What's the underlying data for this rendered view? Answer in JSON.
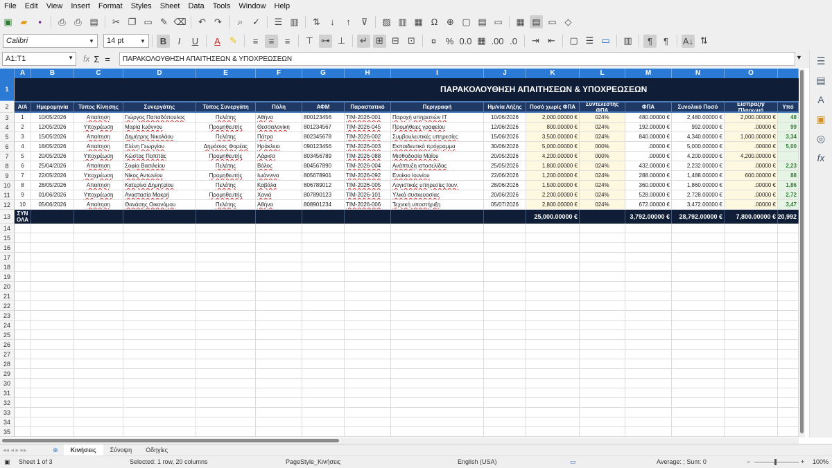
{
  "menu": [
    "File",
    "Edit",
    "View",
    "Insert",
    "Format",
    "Styles",
    "Sheet",
    "Data",
    "Tools",
    "Window",
    "Help"
  ],
  "font": {
    "name": "Calibri",
    "size": "14 pt"
  },
  "format_buttons": {
    "bold": "B",
    "italic": "I",
    "underline": "U"
  },
  "namebox": "A1:T1",
  "formula": "ΠΑΡΑΚΟΛΟΥΘΗΣΗ ΑΠΑΙΤΗΣΕΩΝ & ΥΠΟΧΡΕΩΣΕΩΝ",
  "title": "ΠΑΡΑΚΟΛΟΥΘΗΣΗ ΑΠΑΙΤΗΣΕΩΝ & ΥΠΟΧΡΕΩΣΕΩΝ",
  "column_letters": [
    "A",
    "B",
    "C",
    "D",
    "E",
    "F",
    "G",
    "H",
    "I",
    "J",
    "K",
    "L",
    "M",
    "N",
    "O",
    ""
  ],
  "headers": [
    "Α/Α",
    "Ημερομηνία",
    "Τύπος Κίνησης",
    "Συνεργάτης",
    "Τύπος Συνεργάτη",
    "Πόλη",
    "ΑΦΜ",
    "Παραστατικό",
    "Περιγραφή",
    "Ημ/νία Λήξης",
    "Ποσό χωρίς ΦΠΑ",
    "Συντελεστής ΦΠΑ",
    "ΦΠΑ",
    "Συνολικό Ποσό",
    "Είσπραξη/ Πληρωμή",
    "Υπό"
  ],
  "rows": [
    [
      "1",
      "10/05/2026",
      "Απαίτηση",
      "Γιώργος Παπαδόπουλος",
      "Πελάτης",
      "Αθήνα",
      "800123456",
      "ΤΙΜ-2026-001",
      "Παροχή υπηρεσιών IT",
      "10/06/2026",
      "2,000.00000 €",
      "024%",
      "480.00000 €",
      "2,480.00000 €",
      "2,000.00000 €",
      "48"
    ],
    [
      "2",
      "12/05/2026",
      "Υποχρέωση",
      "Μαρία Ιωάννου",
      "Προμηθευτής",
      "Θεσσαλονίκη",
      "801234567",
      "ΤΙΜ-2026-045",
      "Προμήθειες γραφείου",
      "12/06/2026",
      "800.00000 €",
      "024%",
      "192.00000 €",
      "992.00000 €",
      ".00000 €",
      "99"
    ],
    [
      "3",
      "15/05/2026",
      "Απαίτηση",
      "Δημήτρης Νικολάου",
      "Πελάτης",
      "Πάτρα",
      "802345678",
      "ΤΙΜ-2026-002",
      "Συμβουλευτικές υπηρεσίες",
      "15/06/2026",
      "3,500.00000 €",
      "024%",
      "840.00000 €",
      "4,340.00000 €",
      "1,000.00000 €",
      "3,34"
    ],
    [
      "4",
      "18/05/2026",
      "Απαίτηση",
      "Ελένη Γεωργίου",
      "Δημόσιος Φορέας",
      "Ηράκλειο",
      "090123456",
      "ΤΙΜ-2026-003",
      "Εκπαιδευτικό πρόγραμμα",
      "30/06/2026",
      "5,000.00000 €",
      "000%",
      ".00000 €",
      "5,000.00000 €",
      ".00000 €",
      "5,00"
    ],
    [
      "5",
      "20/05/2026",
      "Υποχρέωση",
      "Κώστας Παππάς",
      "Προμηθευτής",
      "Λάρισα",
      "803456789",
      "ΤΙΜ-2026-088",
      "Μισθοδοσία Μαΐου",
      "20/05/2026",
      "4,200.00000 €",
      "000%",
      ".00000 €",
      "4,200.00000 €",
      "4,200.00000 €",
      ""
    ],
    [
      "6",
      "25/04/2026",
      "Απαίτηση",
      "Σοφία Βασιλείου",
      "Πελάτης",
      "Βόλος",
      "804567890",
      "ΤΙΜ-2026-004",
      "Ανάπτυξη ιστοσελίδας",
      "25/05/2026",
      "1,800.00000 €",
      "024%",
      "432.00000 €",
      "2,232.00000 €",
      ".00000 €",
      "2,23"
    ],
    [
      "7",
      "22/05/2026",
      "Υποχρέωση",
      "Νίκος Αντωνίου",
      "Προμηθευτής",
      "Ιωάννινα",
      "805678901",
      "ΤΙΜ-2026-092",
      "Ενοίκιο Ιουνίου",
      "22/06/2026",
      "1,200.00000 €",
      "024%",
      "288.00000 €",
      "1,488.00000 €",
      "600.00000 €",
      "88"
    ],
    [
      "8",
      "28/05/2026",
      "Απαίτηση",
      "Κατερίνα Δημητρίου",
      "Πελάτης",
      "Καβάλα",
      "806789012",
      "ΤΙΜ-2026-005",
      "Λογιστικές υπηρεσίες Ιουν.",
      "28/06/2026",
      "1,500.00000 €",
      "024%",
      "360.00000 €",
      "1,860.00000 €",
      ".00000 €",
      "1,86"
    ],
    [
      "9",
      "01/06/2026",
      "Υποχρέωση",
      "Αναστασία Μακρή",
      "Προμηθευτής",
      "Χανιά",
      "807890123",
      "ΤΙΜ-2026-101",
      "Υλικά συσκευασίας",
      "20/06/2026",
      "2,200.00000 €",
      "024%",
      "528.00000 €",
      "2,728.00000 €",
      ".00000 €",
      "2,72"
    ],
    [
      "10",
      "05/06/2026",
      "Απαίτηση",
      "Θανάσης Οικονόμου",
      "Πελάτης",
      "Αθήνα",
      "808901234",
      "ΤΙΜ-2026-006",
      "Τεχνική υποστήριξη",
      "05/07/2026",
      "2,800.00000 €",
      "024%",
      "672.00000 €",
      "3,472.00000 €",
      ".00000 €",
      "3,47"
    ]
  ],
  "totals": {
    "label": "ΣΥΝ ΟΛΑ",
    "net": "25,000.00000 €",
    "vat": "3,792.00000 €",
    "total": "28,792.00000 €",
    "paid": "7,800.00000 €",
    "pending": "20,992"
  },
  "row_numbers": [
    "1",
    "2",
    "3",
    "4",
    "5",
    "6",
    "7",
    "8",
    "9",
    "10",
    "11",
    "12",
    "13",
    "14",
    "15",
    "16",
    "17",
    "18",
    "19",
    "20",
    "21",
    "22",
    "23",
    "24",
    "25",
    "26",
    "27",
    "28",
    "29",
    "30",
    "31",
    "32",
    "33",
    "34",
    "35"
  ],
  "sheet_tabs": [
    "Κινήσεις",
    "Σύνοψη",
    "Οδηγίες"
  ],
  "status": {
    "sheet": "Sheet 1 of 3",
    "selection": "Selected: 1 row, 20 columns",
    "page_style": "PageStyle_Κινήσεις",
    "language": "English (USA)",
    "summary": "Average: ; Sum: 0",
    "zoom": "100%"
  },
  "colors": {
    "header_blue": "#2b7bd6",
    "dark_navy": "#0f1d36",
    "header_navy": "#1f3864",
    "pending_green": "#2e7d32"
  }
}
